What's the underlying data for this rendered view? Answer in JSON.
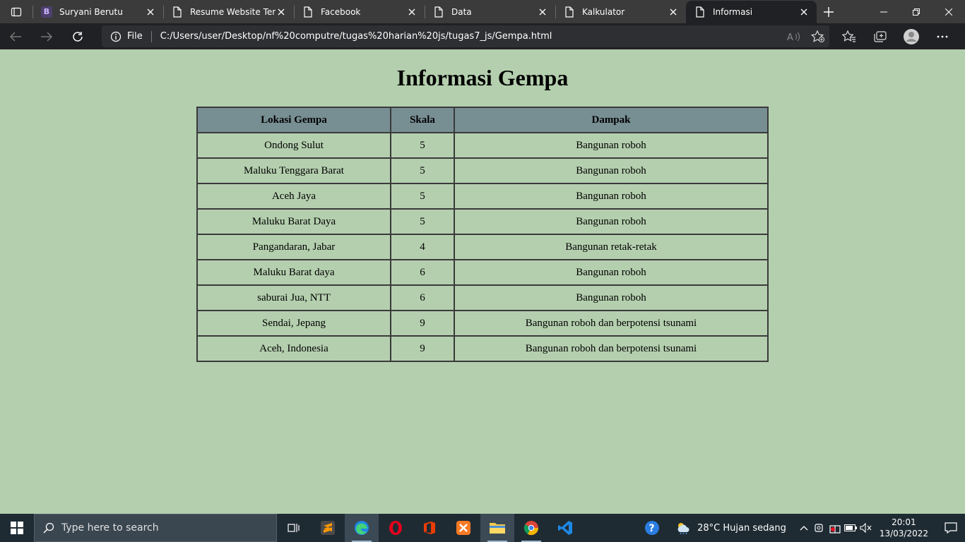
{
  "browser": {
    "tabs": [
      {
        "title": "Suryani Berutu",
        "favicon": "B"
      },
      {
        "title": "Resume Website Temp"
      },
      {
        "title": "Facebook"
      },
      {
        "title": "Data"
      },
      {
        "title": "Kalkulator"
      },
      {
        "title": "Informasi",
        "active": true
      }
    ],
    "address": {
      "scheme_label": "File",
      "url": "C:/Users/user/Desktop/nf%20computre/tugas%20harian%20js/tugas7_js/Gempa.html"
    }
  },
  "page": {
    "title": "Informasi Gempa",
    "table": {
      "headers": [
        "Lokasi Gempa",
        "Skala",
        "Dampak"
      ],
      "rows": [
        [
          "Ondong Sulut",
          "5",
          "Bangunan roboh"
        ],
        [
          "Maluku Tenggara Barat",
          "5",
          "Bangunan roboh"
        ],
        [
          "Aceh Jaya",
          "5",
          "Bangunan roboh"
        ],
        [
          "Maluku Barat Daya",
          "5",
          "Bangunan roboh"
        ],
        [
          "Pangandaran, Jabar",
          "4",
          "Bangunan retak-retak"
        ],
        [
          "Maluku Barat daya",
          "6",
          "Bangunan roboh"
        ],
        [
          "saburai Jua, NTT",
          "6",
          "Bangunan roboh"
        ],
        [
          "Sendai, Jepang",
          "9",
          "Bangunan roboh dan berpotensi tsunami"
        ],
        [
          "Aceh, Indonesia",
          "9",
          "Bangunan roboh dan berpotensi tsunami"
        ]
      ]
    }
  },
  "taskbar": {
    "search_placeholder": "Type here to search",
    "weather": "28°C  Hujan sedang",
    "time": "20:01",
    "date": "13/03/2022"
  },
  "colors": {
    "page_bg": "#b4cfae",
    "table_header_bg": "#778e93",
    "tabbar_bg": "#3b3b3b",
    "toolbar_bg": "#202124",
    "taskbar_bg": "#1f2b33"
  }
}
